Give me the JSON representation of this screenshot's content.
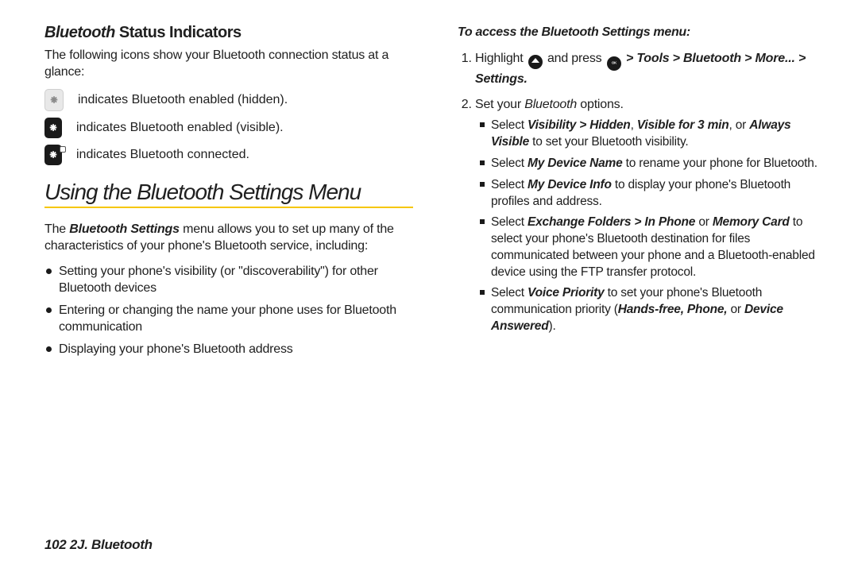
{
  "left": {
    "h2_ital": "Bluetooth",
    "h2_rest": " Status Indicators",
    "intro": "The following icons show your Bluetooth connection status at a glance:",
    "icons": {
      "hidden": "indicates Bluetooth enabled (hidden).",
      "visible": "indicates Bluetooth enabled (visible).",
      "connected": "indicates Bluetooth connected."
    },
    "h1": "Using the Bluetooth Settings Menu",
    "para_pre": "The ",
    "para_bold": "Bluetooth Settings",
    "para_post": " menu allows you to set up many of the characteristics of your phone's Bluetooth service, including:",
    "bullets": {
      "b1": "Setting your phone's visibility (or \"discoverability\") for other Bluetooth devices",
      "b2": "Entering or changing the name your phone uses for Bluetooth communication",
      "b3": "Displaying your phone's Bluetooth address"
    }
  },
  "right": {
    "lead": "To access the Bluetooth Settings menu:",
    "step1": {
      "pre": "Highlight ",
      "mid": " and press ",
      "gt1": " > ",
      "tools": "Tools",
      "bluetooth": "Bluetooth",
      "more": "More...",
      "settings": "Settings",
      "dot": "."
    },
    "step2": {
      "pre": "Set your ",
      "bt": "Bluetooth",
      "post": " options."
    },
    "sub": {
      "s1_a": "Select ",
      "s1_vis": "Visibility > Hidden",
      "s1_comma": ", ",
      "s1_v3": "Visible for 3 min",
      "s1_or": ", or ",
      "s1_always": "Always Visible",
      "s1_tail": " to set your Bluetooth visibility.",
      "s2_a": "Select ",
      "s2_b": "My Device Name",
      "s2_c": " to rename your phone for Bluetooth.",
      "s3_a": "Select ",
      "s3_b": "My Device Info",
      "s3_c": " to display your phone's Bluetooth profiles and address.",
      "s4_a": "Select ",
      "s4_b": "Exchange Folders > In Phone",
      "s4_or": " or ",
      "s4_c": "Memory Card",
      "s4_d": " to select your phone's Bluetooth destination for files communicated between your phone and a Bluetooth-enabled device using the FTP transfer protocol.",
      "s5_a": "Select ",
      "s5_b": "Voice Priority",
      "s5_c": " to set your phone's Bluetooth communication priority (",
      "s5_d": "Hands-free, Phone,",
      "s5_e": " or ",
      "s5_f": "Device Answered",
      "s5_g": ")."
    }
  },
  "footer": "102    2J. Bluetooth",
  "ok_label": "MENU OK"
}
